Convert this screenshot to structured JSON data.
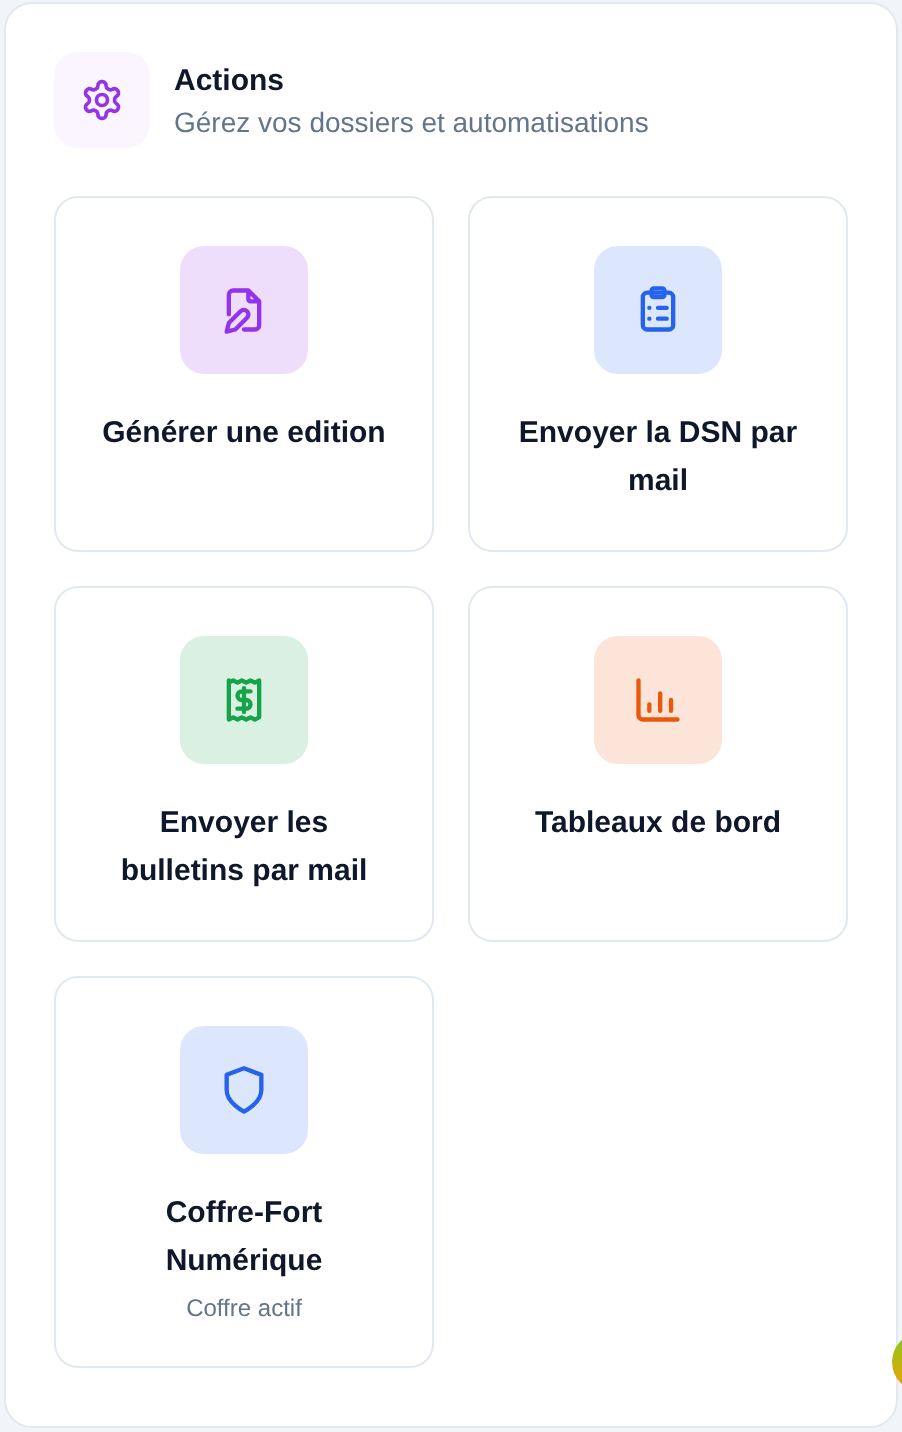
{
  "header": {
    "title": "Actions",
    "subtitle": "Gérez vos dossiers et automatisations"
  },
  "actions": [
    {
      "kind": "document",
      "label": "Générer une edition",
      "color": "#9333ea"
    },
    {
      "kind": "clipboard",
      "label": "Envoyer la DSN par mail",
      "color": "#2563eb"
    },
    {
      "kind": "receipt",
      "label": "Envoyer les bulletins par mail",
      "color": "#16a34a"
    },
    {
      "kind": "chart",
      "label": "Tableaux de bord",
      "color": "#ea580c"
    },
    {
      "kind": "shield",
      "label": "Coffre-Fort Numérique",
      "status": "Coffre actif",
      "color": "#2563eb"
    }
  ]
}
